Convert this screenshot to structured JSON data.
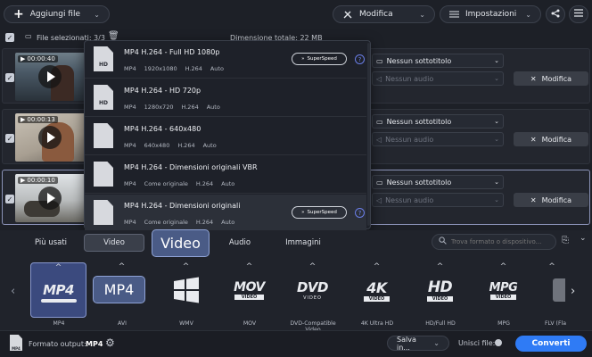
{
  "toolbar": {
    "add_files": "Aggiungi file",
    "edit": "Modifica",
    "settings": "Impostazioni"
  },
  "files_bar": {
    "selected": "File selezionati: 3/3",
    "total_size": "Dimensione totale: 22 MB"
  },
  "rows": [
    {
      "time": "00:00:40",
      "subtitle": "Nessun sottotitolo",
      "audio": "Nessun audio",
      "edit": "Modifica"
    },
    {
      "time": "00:00:13",
      "subtitle": "Nessun sottotitolo",
      "audio": "Nessun audio",
      "edit": "Modifica"
    },
    {
      "time": "00:00:10",
      "subtitle": "Nessun sottotitolo",
      "audio": "Nessun audio",
      "edit": "Modifica"
    }
  ],
  "presets": [
    {
      "title": "MP4 H.264 - Full HD 1080p",
      "meta": [
        "MP4",
        "1920x1080",
        "H.264",
        "Auto"
      ],
      "superspeed": "SuperSpeed",
      "icon_label": "HD"
    },
    {
      "title": "MP4 H.264 - HD 720p",
      "meta": [
        "MP4",
        "1280x720",
        "H.264",
        "Auto"
      ],
      "superspeed": "",
      "icon_label": "HD"
    },
    {
      "title": "MP4 H.264 - 640x480",
      "meta": [
        "MP4",
        "640x480",
        "H.264",
        "Auto"
      ],
      "superspeed": "",
      "icon_label": ""
    },
    {
      "title": "MP4 H.264 - Dimensioni originali VBR",
      "meta": [
        "MP4",
        "Come originale",
        "H.264",
        "Auto"
      ],
      "superspeed": "",
      "icon_label": ""
    },
    {
      "title": "MP4 H.264 - Dimensioni originali",
      "meta": [
        "MP4",
        "Come originale",
        "H.264",
        "Auto"
      ],
      "superspeed": "SuperSpeed",
      "icon_label": ""
    }
  ],
  "tabs": [
    "Più usati",
    "Video",
    "Audio",
    "Immagini"
  ],
  "active_tab": "Video",
  "search_placeholder": "Trova formato o dispositivo...",
  "formats": [
    {
      "logo": "MP4",
      "label": "MP4"
    },
    {
      "logo": "AVI",
      "label": "AVI"
    },
    {
      "logo": "WMV",
      "label": "WMV"
    },
    {
      "logo": "MOV",
      "label": "MOV"
    },
    {
      "logo": "DVD",
      "label": "DVD-Compatible Video"
    },
    {
      "logo": "4K",
      "label": "4K Ultra HD"
    },
    {
      "logo": "HD",
      "label": "HD/Full HD"
    },
    {
      "logo": "MPG",
      "label": "MPG"
    },
    {
      "logo": "FLV",
      "label": "FLV (Fla"
    }
  ],
  "tooltips": {
    "tab": "Video",
    "format": "MP4"
  },
  "bottom": {
    "output_label": "Formato output:",
    "output_value": "MP4",
    "save_in": "Salva in...",
    "merge": "Unisci file:",
    "convert": "Converti"
  },
  "colors": {
    "accent": "#2f7bf5",
    "selected_tile": "#3b4a7e",
    "tooltip": "#4a5b86"
  }
}
